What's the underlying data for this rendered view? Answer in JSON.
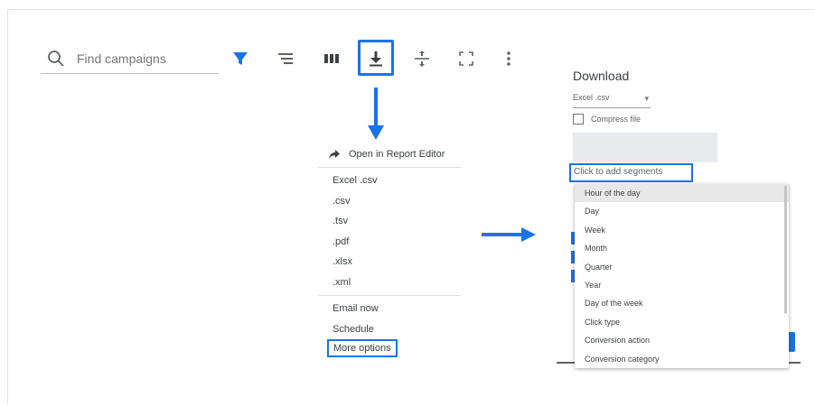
{
  "search": {
    "placeholder": "Find campaigns",
    "icon": "search-icon"
  },
  "toolbar": {
    "icons": [
      "filter-icon",
      "segment-icon",
      "columns-icon",
      "download-icon",
      "expand-rows-icon",
      "fullscreen-icon",
      "more-vert-icon"
    ],
    "accent": "#1a73e8"
  },
  "download_menu": {
    "open_editor": "Open in Report Editor",
    "formats": [
      "Excel .csv",
      ".csv",
      ".tsv",
      ".pdf",
      ".xlsx",
      ".xml"
    ],
    "actions": [
      "Email now",
      "Schedule"
    ],
    "more_options": "More options"
  },
  "download_panel": {
    "title": "Download",
    "format_value": "Excel .csv",
    "compress_label": "Compress file",
    "segments_placeholder": "Click to add segments",
    "segment_options": [
      "Hour of the day",
      "Day",
      "Week",
      "Month",
      "Quarter",
      "Year",
      "Day of the week",
      "Click type",
      "Conversion action",
      "Conversion category"
    ]
  }
}
